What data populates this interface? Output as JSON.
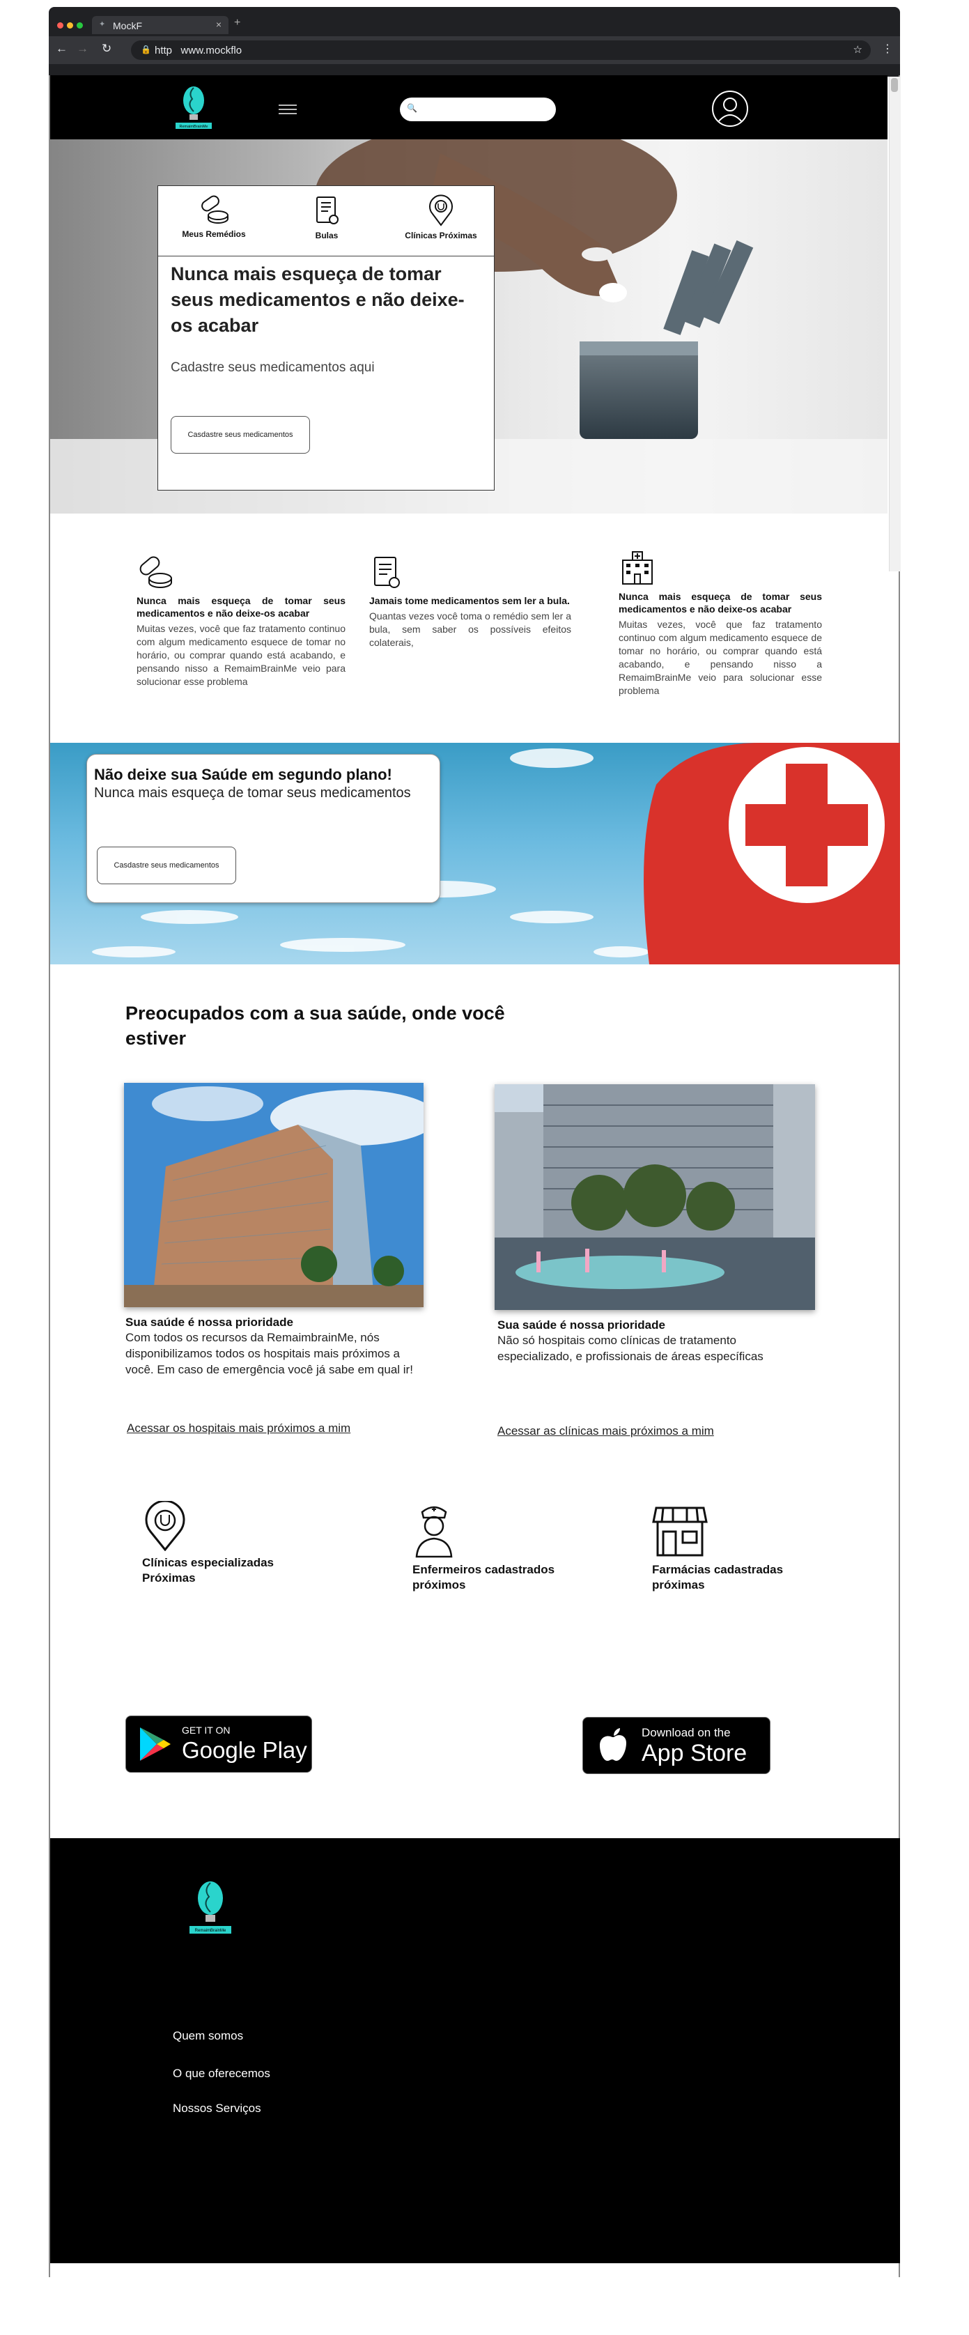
{
  "browser": {
    "tab_title": "MockF",
    "tab_close": "×",
    "new_tab": "+",
    "url_scheme": "http",
    "url": "www.mockflo",
    "back": "←",
    "forward": "→",
    "reload": "↻",
    "lock": "🔒",
    "bookmark": "☆",
    "menu": "⋮",
    "colors": {
      "frame": "#202124",
      "toolbar": "#35363a"
    }
  },
  "header": {
    "logo_text": "RemaimBrainMe",
    "search": {
      "placeholder": "",
      "icon": "search-icon"
    },
    "menu_icon": "hamburger-icon",
    "avatar_icon": "user-icon"
  },
  "hero": {
    "tabs": [
      {
        "label": "Meus Remédios",
        "icon": "pills-icon"
      },
      {
        "label": "Bulas",
        "icon": "prescription-icon"
      },
      {
        "label": "Clínicas Próximas",
        "icon": "stethoscope-pin-icon"
      }
    ],
    "title": "Nunca mais esqueça de tomar seus medicamentos e não deixe-os acabar",
    "subtitle": "Cadastre seus medicamentos aqui",
    "button": "Casdastre seus medicamentos"
  },
  "features": [
    {
      "icon": "pills-icon",
      "title": "Nunca mais esqueça de tomar seus medicamentos e não deixe-os acabar",
      "desc": "Muitas vezes, você que faz tratamento continuo com algum medicamento esquece de tomar no horário, ou comprar quando está acabando, e pensando nisso a RemaimBrainMe veio para solucionar esse problema"
    },
    {
      "icon": "prescription-icon",
      "title": "Jamais tome medicamentos sem ler a bula.",
      "desc": "Quantas vezes você toma o remédio sem ler a bula, sem saber os possíveis efeitos colaterais,"
    },
    {
      "icon": "hospital-icon",
      "title": "Nunca mais esqueça de tomar seus medicamentos e não deixe-os acabar",
      "desc": "Muitas vezes, você que faz tratamento continuo com algum medicamento esquece de tomar no horário, ou comprar quando está acabando, e pensando nisso a RemaimBrainMe veio para solucionar esse problema"
    }
  ],
  "banner": {
    "title": "Não deixe sua Saúde em segundo plano!",
    "subtitle": "Nunca mais esqueça de tomar seus medicamentos",
    "button": "Casdastre seus medicamentos"
  },
  "care": {
    "title": "Preocupados com a sua saúde, onde você estiver",
    "cards": [
      {
        "title": "Sua saúde é nossa prioridade",
        "desc": "Com todos os recursos da RemaimbrainMe, nós disponibilizamos todos os hospitais mais próximos a você. Em caso de emergência você já sabe em qual ir!",
        "link": "Acessar os hospitais mais próximos a mim"
      },
      {
        "title": "Sua saúde é nossa prioridade",
        "desc": "Não só hospitais como clínicas de tratamento especializado, e profissionais de áreas específicas",
        "link": "Acessar as clínicas mais próximos a mim"
      }
    ]
  },
  "services": [
    {
      "label": "Clínicas especializadas Próximas",
      "icon": "stethoscope-pin-icon"
    },
    {
      "label": "Enfermeiros cadastrados próximos",
      "icon": "nurse-icon"
    },
    {
      "label": "Farmácias cadastradas próximas",
      "icon": "store-icon"
    }
  ],
  "stores": {
    "google": {
      "small": "GET IT ON",
      "big": "Google Play"
    },
    "apple": {
      "small": "Download on the",
      "big": "App Store"
    }
  },
  "footer": {
    "logo_text": "RemaimBrainMe",
    "links": [
      "Quem somos",
      "O que oferecemos",
      "Nossos Serviços"
    ]
  }
}
